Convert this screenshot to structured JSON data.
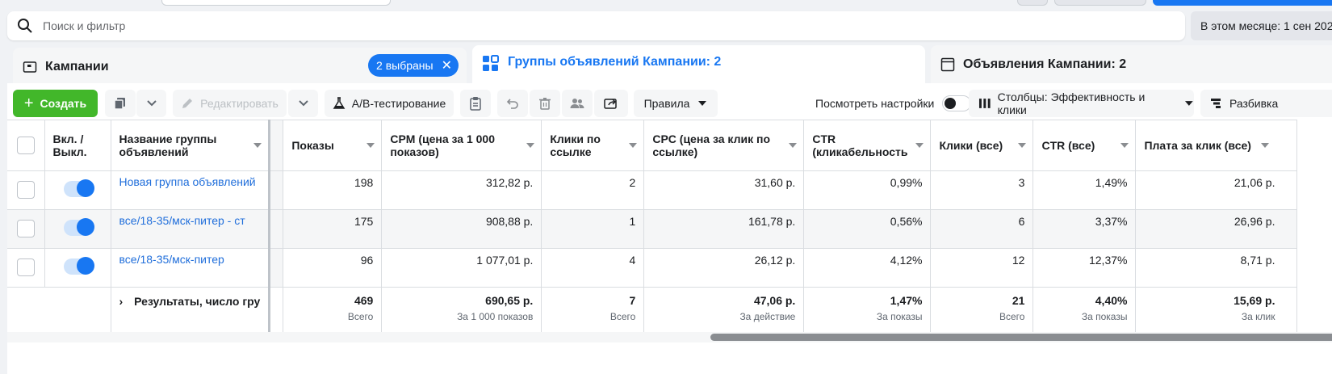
{
  "search": {
    "placeholder": "Поиск и фильтр"
  },
  "date_range": "В этом месяце: 1 сен 202",
  "tabs": {
    "campaigns": {
      "label": "Кампании",
      "selected_pill": "2 выбраны"
    },
    "adsets": {
      "label": "Группы объявлений Кампании: 2"
    },
    "ads": {
      "label": "Объявления Кампании: 2"
    }
  },
  "toolbar": {
    "create": "Создать",
    "edit": "Редактировать",
    "ab_test": "A/B-тестирование",
    "rules": "Правила",
    "view_settings": "Посмотреть настройки",
    "columns": "Столбцы: Эффективность и клики",
    "breakdown": "Разбивка"
  },
  "columns": {
    "onoff": [
      "Вкл. /",
      "Выкл."
    ],
    "name": [
      "Название группы",
      "объявлений"
    ],
    "impressions": [
      "Показы"
    ],
    "cpm": [
      "CPM (цена за 1 000",
      "показов)"
    ],
    "link_clicks": [
      "Клики по",
      "ссылке"
    ],
    "cpc": [
      "CPC (цена за клик по",
      "ссылке)"
    ],
    "ctr": [
      "CTR",
      "(кликабельность"
    ],
    "clicks_all": [
      "Клики (все)"
    ],
    "ctr_all": [
      "CTR (все)"
    ],
    "cost_per_click": [
      "Плата за клик (все)"
    ]
  },
  "rows": [
    {
      "name": "Новая группа объявлений",
      "impressions": "198",
      "cpm": "312,82 р.",
      "link_clicks": "2",
      "cpc": "31,60 р.",
      "ctr": "0,99%",
      "clicks_all": "3",
      "ctr_all": "1,49%",
      "cost_per_click": "21,06 р."
    },
    {
      "name": "все/18-35/мск-питер - ст",
      "impressions": "175",
      "cpm": "908,88 р.",
      "link_clicks": "1",
      "cpc": "161,78 р.",
      "ctr": "0,56%",
      "clicks_all": "6",
      "ctr_all": "3,37%",
      "cost_per_click": "26,96 р."
    },
    {
      "name": "все/18-35/мск-питер",
      "impressions": "96",
      "cpm": "1 077,01 р.",
      "link_clicks": "4",
      "cpc": "26,12 р.",
      "ctr": "4,12%",
      "clicks_all": "12",
      "ctr_all": "12,37%",
      "cost_per_click": "8,71 р."
    }
  ],
  "totals": {
    "label": "Результаты, число гру",
    "impressions": {
      "value": "469",
      "sub": "Всего"
    },
    "cpm": {
      "value": "690,65 р.",
      "sub": "За 1 000 показов"
    },
    "link_clicks": {
      "value": "7",
      "sub": "Всего"
    },
    "cpc": {
      "value": "47,06 р.",
      "sub": "За действие"
    },
    "ctr": {
      "value": "1,47%",
      "sub": "За показы"
    },
    "clicks_all": {
      "value": "21",
      "sub": "Всего"
    },
    "ctr_all": {
      "value": "4,40%",
      "sub": "За показы"
    },
    "cost_per_click": {
      "value": "15,69 р.",
      "sub": "За клик"
    }
  },
  "colors": {
    "accent": "#1877f2",
    "create_green": "#42b72a",
    "link": "#216fdb"
  }
}
